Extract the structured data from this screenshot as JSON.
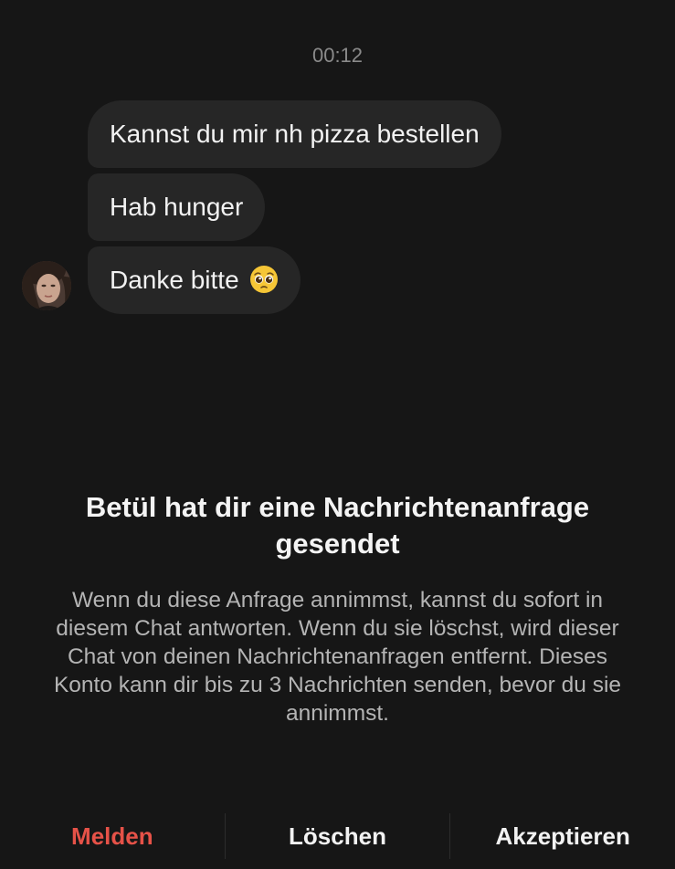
{
  "thread": {
    "timestamp": "00:12",
    "messages": [
      {
        "text": "Kannst du mir nh pizza bestellen"
      },
      {
        "text": "Hab hunger"
      },
      {
        "text": "Danke bitte",
        "emoji": "pleading-face-emoji"
      }
    ],
    "sender_avatar_icon": "user-avatar"
  },
  "request": {
    "title": "Betül hat dir eine Nachrichtenanfrage gesendet",
    "body": "Wenn du diese Anfrage annimmst, kannst du sofort in diesem Chat antworten. Wenn du sie löschst, wird dieser Chat von deinen Nachrichtenanfragen entfernt. Dieses Konto kann dir bis zu 3 Nachrichten senden, bevor du sie annimmst."
  },
  "actions": {
    "report": "Melden",
    "delete": "Löschen",
    "accept": "Akzeptieren"
  },
  "colors": {
    "background": "#161616",
    "bubble": "#262626",
    "report": "#e65248",
    "muted_text": "#b4b4b4"
  }
}
